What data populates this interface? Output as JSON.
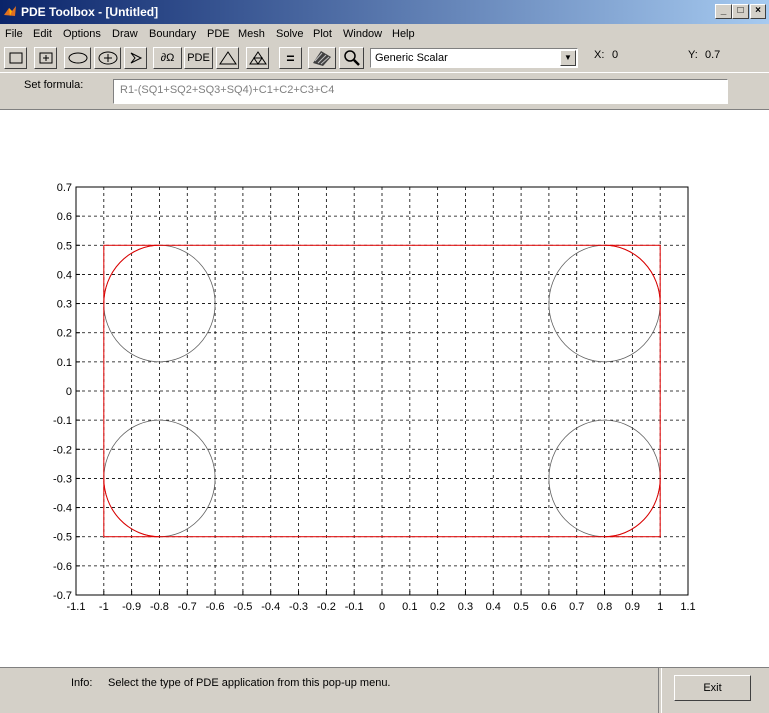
{
  "window": {
    "title": "PDE Toolbox - [Untitled]"
  },
  "menu": [
    "File",
    "Edit",
    "Options",
    "Draw",
    "Boundary",
    "PDE",
    "Mesh",
    "Solve",
    "Plot",
    "Window",
    "Help"
  ],
  "toolbar": {
    "pde_label": "PDE",
    "domain_label": "∂Ω",
    "equals_label": "=",
    "application_select": "Generic Scalar"
  },
  "coords": {
    "x_label": "X:",
    "x_value": "0",
    "y_label": "Y:",
    "y_value": "0.7"
  },
  "formula": {
    "label": "Set formula:",
    "value": "R1-(SQ1+SQ2+SQ3+SQ4)+C1+C2+C3+C4"
  },
  "status": {
    "info_label": "Info:",
    "info_text": "Select the type of PDE application from this pop-up menu.",
    "exit_label": "Exit"
  },
  "chart_data": {
    "type": "line",
    "xlim": [
      -1.1,
      1.1
    ],
    "ylim": [
      -0.7,
      0.7
    ],
    "xticks": [
      "-1.1",
      "-1",
      "-0.9",
      "-0.8",
      "-0.7",
      "-0.6",
      "-0.5",
      "-0.4",
      "-0.3",
      "-0.2",
      "-0.1",
      "0",
      "0.1",
      "0.2",
      "0.3",
      "0.4",
      "0.5",
      "0.6",
      "0.7",
      "0.8",
      "0.9",
      "1",
      "1.1"
    ],
    "yticks": [
      "0.7",
      "0.6",
      "0.5",
      "0.4",
      "0.3",
      "0.2",
      "0.1",
      "0",
      "-0.1",
      "-0.2",
      "-0.3",
      "-0.4",
      "-0.5",
      "-0.6",
      "-0.7"
    ],
    "grid": true,
    "rectangle": {
      "x": [
        -1,
        1
      ],
      "y": [
        -0.5,
        0.5
      ],
      "color": "#e00000"
    },
    "circles": [
      {
        "cx": -0.8,
        "cy": 0.3,
        "r": 0.2
      },
      {
        "cx": 0.8,
        "cy": 0.3,
        "r": 0.2
      },
      {
        "cx": -0.8,
        "cy": -0.3,
        "r": 0.2
      },
      {
        "cx": 0.8,
        "cy": -0.3,
        "r": 0.2
      }
    ],
    "circle_color": "#606060"
  }
}
